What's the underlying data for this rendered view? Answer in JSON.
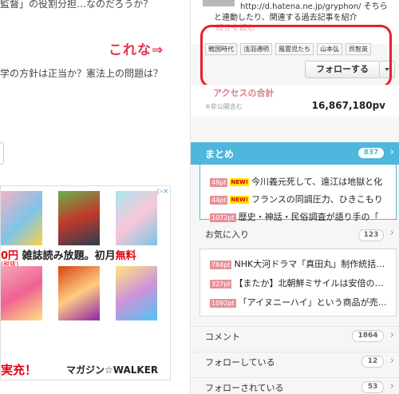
{
  "article": {
    "line_top": "監督」の役割分担…なのだろうか？",
    "annotation": "これな⇒",
    "line_mid": "学の方針は正当か？憲法上の問題は？"
  },
  "ad": {
    "chip": "▷×",
    "promo_left": "0円",
    "promo_mid": "雑誌読み放題。初月",
    "promo_red": "無料",
    "promo_tax": "(税抜)",
    "bottom_left": "実充！",
    "brand": "マガジン☆WALKER"
  },
  "profile": {
    "url": "http://d.hatena.ne.jp/gryphon/ そちら",
    "desc": "と連動したり、関連する過去記事を紹介",
    "more_link": "続きを読む",
    "tags": [
      "戦国時代",
      "浅羽通明",
      "風雲児たち",
      "山本弘",
      "呉智英"
    ],
    "follow_label": "フォローする"
  },
  "stats": {
    "label": "アクセスの合計",
    "note": "※非公開含む",
    "pv": "16,867,180pv"
  },
  "matome": {
    "title": "まとめ",
    "count": "837",
    "items": [
      {
        "pt": "48pt",
        "new": "NEW!",
        "text": "今川義元死して、遠江は地獄と化"
      },
      {
        "pt": "44pt",
        "new": "NEW!",
        "text": "フランスの同調圧力、ひきこもり"
      },
      {
        "pt": "1072pt",
        "new": "",
        "text": "歴史・神話・民俗調査が語り手の「"
      }
    ]
  },
  "favorites": {
    "title": "お気に入り",
    "count": "123",
    "items": [
      {
        "pt": "784pt",
        "text": "NHK大河ドラマ「真田丸」制作統括…"
      },
      {
        "pt": "327pt",
        "text": "【またか】北朝鮮ミサイルは安倍の…"
      },
      {
        "pt": "1092pt",
        "text": "「アイヌニーハイ」という商品が売…"
      }
    ]
  },
  "lists": [
    {
      "label": "コメント",
      "count": "1864"
    },
    {
      "label": "フォローしている",
      "count": "12"
    },
    {
      "label": "フォローされている",
      "count": "53"
    }
  ],
  "colors": {
    "accent_red": "#e8202a",
    "matome_blue": "#4fb7dd",
    "badge_pink": "#e8909a"
  }
}
